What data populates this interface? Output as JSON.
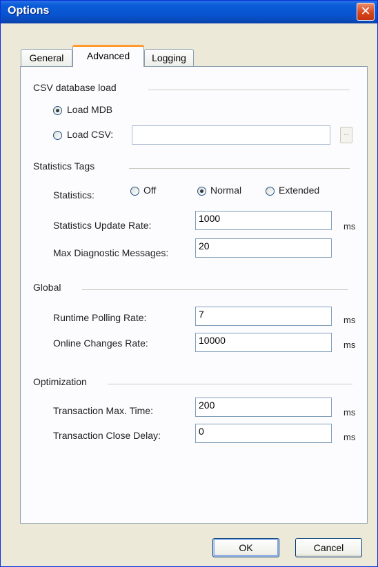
{
  "window": {
    "title": "Options",
    "close_symbol": "✕"
  },
  "tabs": [
    {
      "label": "General"
    },
    {
      "label": "Advanced",
      "active": true
    },
    {
      "label": "Logging"
    }
  ],
  "csv_group": {
    "title": "CSV database load",
    "load_mdb_label": "Load MDB",
    "load_mdb_selected": true,
    "load_csv_label": "Load CSV:",
    "load_csv_selected": false,
    "csv_path_value": "",
    "browse_label": "..."
  },
  "statistics_group": {
    "title": "Statistics Tags",
    "statistics_label": "Statistics:",
    "options": [
      {
        "label": "Off",
        "selected": false
      },
      {
        "label": "Normal",
        "selected": true
      },
      {
        "label": "Extended",
        "selected": false
      }
    ],
    "update_rate_label": "Statistics Update Rate:",
    "update_rate_value": "1000",
    "update_rate_unit": "ms",
    "max_diag_label": "Max Diagnostic Messages:",
    "max_diag_value": "20"
  },
  "global_group": {
    "title": "Global",
    "polling_label": "Runtime Polling Rate:",
    "polling_value": "7",
    "polling_unit": "ms",
    "online_label": "Online Changes Rate:",
    "online_value": "10000",
    "online_unit": "ms"
  },
  "optimization_group": {
    "title": "Optimization",
    "max_time_label": "Transaction Max. Time:",
    "max_time_value": "200",
    "max_time_unit": "ms",
    "close_delay_label": "Transaction Close Delay:",
    "close_delay_value": "0",
    "close_delay_unit": "ms"
  },
  "buttons": {
    "ok": "OK",
    "cancel": "Cancel"
  }
}
